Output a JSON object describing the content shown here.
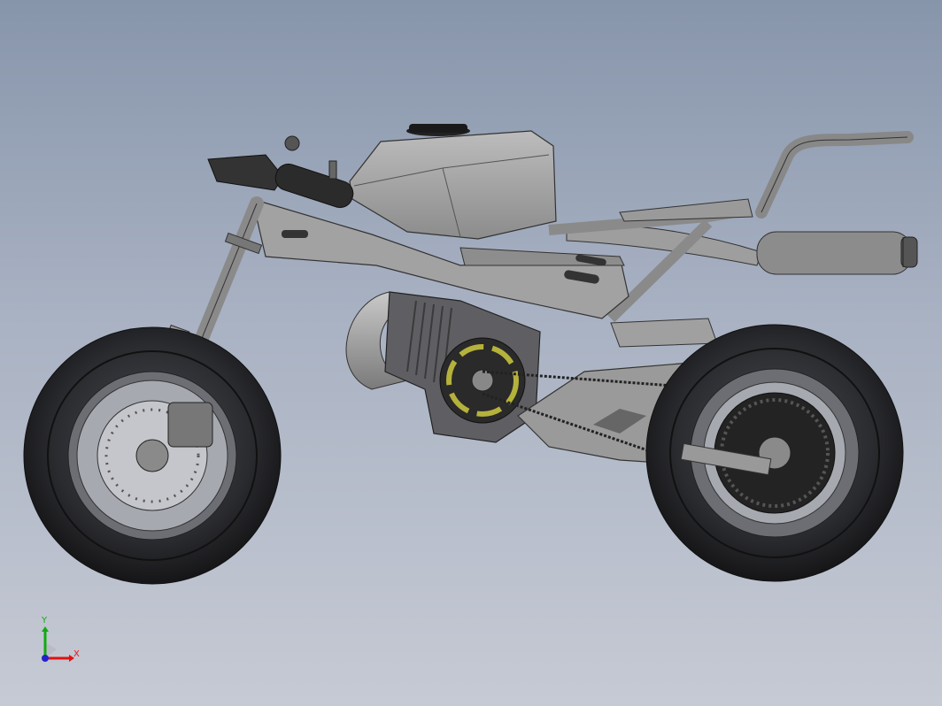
{
  "viewport": {
    "background_top": "#8795ab",
    "background_bottom": "#c6cad4"
  },
  "model": {
    "label": "motorcycle-assembly"
  },
  "axis_triad": {
    "x_label": "X",
    "y_label": "Y",
    "x_color": "#e11111",
    "y_color": "#11aa11",
    "z_color": "#2222cc"
  }
}
